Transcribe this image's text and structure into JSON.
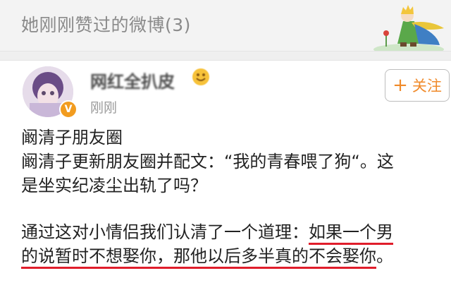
{
  "header": {
    "title": "她刚刚赞过的微博(3)"
  },
  "post": {
    "author": {
      "name": "网红全扒皮",
      "time": "刚刚",
      "verified_badge": "V"
    },
    "follow_button": {
      "label": "关注",
      "icon": "+"
    },
    "content": {
      "line1": "阚清子朋友圈",
      "line2": "阚清子更新朋友圈并配文：“我的青春喂了狗“。这",
      "line3": "是坐实纪凌尘出轨了吗？",
      "line4_plain": "通过这对小情侣我们认清了一个道理：",
      "line4_highlight": "如果一个男",
      "line5_highlight": "的说暂时不想娶你，那他以后多半真的不会娶你",
      "line5_tail": "。"
    }
  },
  "colors": {
    "accent_orange": "#f08a2a",
    "underline_red": "#e01d2b",
    "header_bg": "#f3f3f3",
    "header_text": "#8a8a8a",
    "verified_badge": "#f29c1f"
  },
  "icons": {
    "header_decoration": "little-prince-illustration",
    "verified": "verified-badge-icon",
    "emoji": "smiley-emoji-icon",
    "follow": "plus-icon"
  }
}
